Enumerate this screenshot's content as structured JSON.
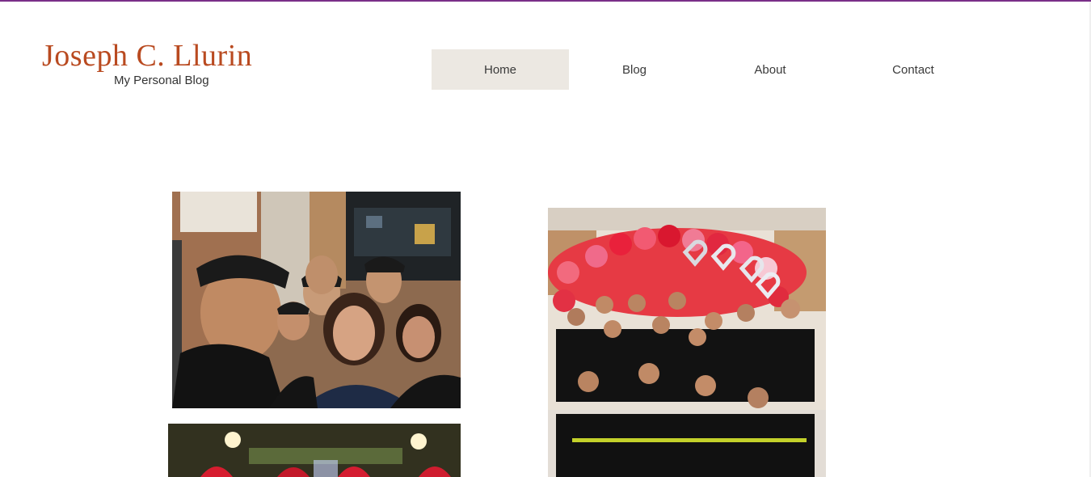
{
  "header": {
    "title": "Joseph C. Llurin",
    "subtitle": "My Personal Blog"
  },
  "nav": {
    "items": [
      {
        "label": "Home",
        "active": true
      },
      {
        "label": "Blog",
        "active": false
      },
      {
        "label": "About",
        "active": false
      },
      {
        "label": "Contact",
        "active": false
      }
    ]
  },
  "colors": {
    "accent_line": "#7a2e88",
    "brand": "#b94a20",
    "nav_active_bg": "#ece8e2"
  }
}
